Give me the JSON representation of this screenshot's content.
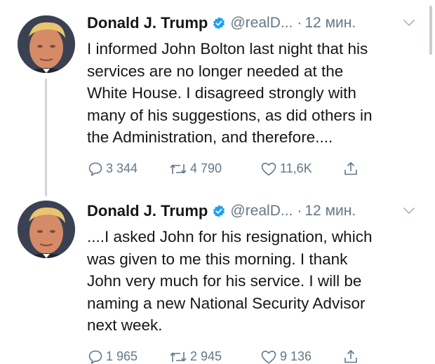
{
  "colors": {
    "verified": "#1da1f2",
    "secondary_text": "#657786",
    "primary_text": "#14171a",
    "thread_line": "#ccd6dd"
  },
  "icons": {
    "reply": "reply-icon",
    "retweet": "retweet-icon",
    "like": "heart-icon",
    "share": "share-icon",
    "verified": "verified-badge-icon",
    "menu": "chevron-down-icon"
  },
  "tweets": [
    {
      "name": "Donald J. Trump",
      "handle": "@realD...",
      "separator": "·",
      "time": "12 мин.",
      "lines": [
        "I informed John Bolton last night that his",
        "services are no longer needed at the",
        "White House. I disagreed strongly with",
        "many of his suggestions, as did others in",
        "the Administration, and therefore...."
      ],
      "replies": "3 344",
      "retweets": "4 790",
      "likes": "11,6K"
    },
    {
      "name": "Donald J. Trump",
      "handle": "@realD...",
      "separator": "·",
      "time": "12 мин.",
      "lines": [
        "....I asked John for his resignation, which",
        "was given to me this morning. I thank",
        "John very much for his service. I will be",
        "naming a new National Security Advisor",
        "next week."
      ],
      "replies": "1 965",
      "retweets": "2 945",
      "likes": "9 136"
    }
  ]
}
